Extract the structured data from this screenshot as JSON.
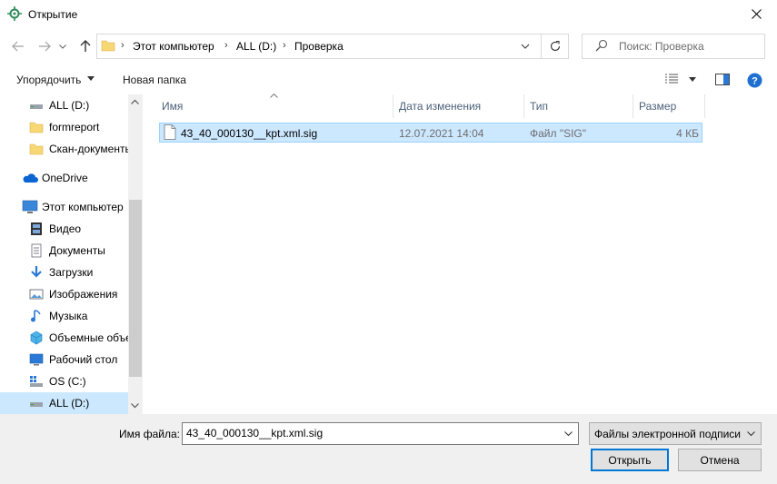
{
  "window": {
    "title": "Открытие",
    "close_icon": "close-icon"
  },
  "address": {
    "crumbs": [
      "Этот компьютер",
      "ALL (D:)",
      "Проверка"
    ],
    "search_placeholder": "Поиск: Проверка"
  },
  "toolbar": {
    "organize": "Упорядочить",
    "new_folder": "Новая папка"
  },
  "nav": {
    "items": [
      {
        "label": "ALL (D:)",
        "icon": "drive-icon"
      },
      {
        "label": "formreport",
        "icon": "folder-icon"
      },
      {
        "label": "Скан-документы",
        "icon": "folder-icon"
      },
      {
        "label": "OneDrive",
        "icon": "cloud-icon"
      },
      {
        "label": "Этот компьютер",
        "icon": "computer-icon"
      },
      {
        "label": "Видео",
        "icon": "video-icon"
      },
      {
        "label": "Документы",
        "icon": "documents-icon"
      },
      {
        "label": "Загрузки",
        "icon": "download-icon"
      },
      {
        "label": "Изображения",
        "icon": "pictures-icon"
      },
      {
        "label": "Музыка",
        "icon": "music-icon"
      },
      {
        "label": "Объемные объекты",
        "icon": "3d-objects-icon"
      },
      {
        "label": "Рабочий стол",
        "icon": "desktop-icon"
      },
      {
        "label": "OS (C:)",
        "icon": "os-drive-icon"
      },
      {
        "label": "ALL (D:)",
        "icon": "drive-icon"
      }
    ]
  },
  "columns": {
    "name": "Имя",
    "date": "Дата изменения",
    "type": "Тип",
    "size": "Размер"
  },
  "files": [
    {
      "name": "43_40_000130__kpt.xml.sig",
      "date": "12.07.2021 14:04",
      "type": "Файл \"SIG\"",
      "size": "4 КБ"
    }
  ],
  "footer": {
    "filename_label": "Имя файла:",
    "filename_value": "43_40_000130__kpt.xml.sig",
    "filter_value": "Файлы электронной подписи",
    "open_label": "Открыть",
    "cancel_label": "Отмена"
  },
  "colors": {
    "selection": "#cce8ff",
    "selection_border": "#99d1ff",
    "accent": "#0078d7",
    "help": "#1e6fd0"
  }
}
